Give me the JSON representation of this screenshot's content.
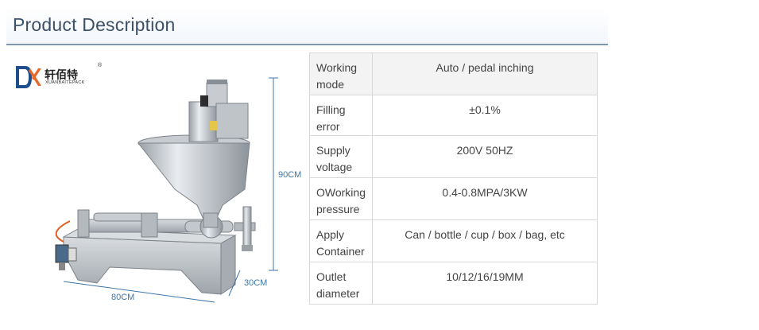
{
  "header": {
    "title": "Product Description"
  },
  "logo": {
    "chinese": "轩佰特",
    "english": "XUANBAITEPACK",
    "registered": "®"
  },
  "dimensions": {
    "height": "90CM",
    "width": "80CM",
    "depth": "30CM"
  },
  "specs": [
    {
      "label": "Working mode",
      "value": "Auto / pedal inching"
    },
    {
      "label": "Filling error",
      "value": "±0.1%"
    },
    {
      "label": "Supply voltage",
      "value": "200V 50HZ"
    },
    {
      "label": "OWorking pressure",
      "value": "0.4-0.8MPA/3KW"
    },
    {
      "label": "Apply Container",
      "value": "Can / bottle / cup / box / bag, etc"
    },
    {
      "label": "Outlet diameter",
      "value": "10/12/16/19MM"
    }
  ],
  "colors": {
    "header_text": "#3c5068",
    "header_rule": "#7e97b3",
    "dimension": "#3d76a8",
    "logo_blue": "#1f4e8c",
    "logo_orange": "#e8682a"
  }
}
